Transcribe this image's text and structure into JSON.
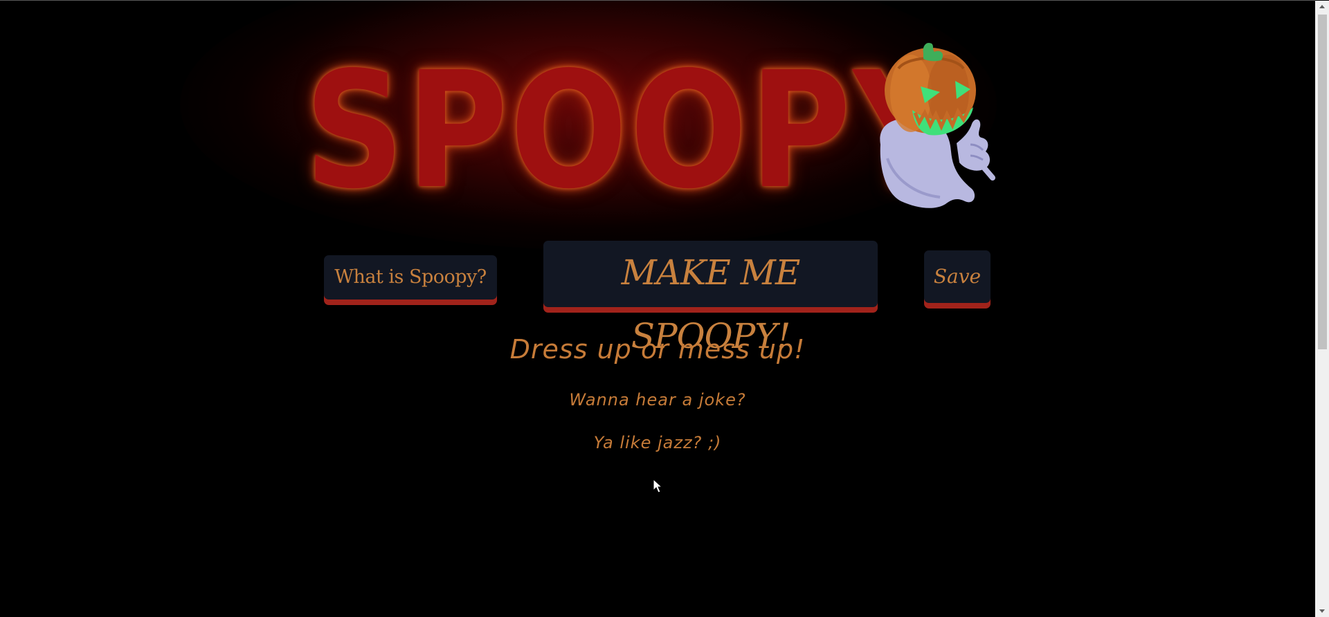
{
  "logo": {
    "text": "SPOOPY",
    "mascot_icon": "ghost-pumpkin-icon"
  },
  "buttons": {
    "what_label": "What is Spoopy?",
    "make_label": "MAKE ME SPOOPY!",
    "save_label": "Save"
  },
  "content": {
    "heading": "Dress up or mess up!",
    "joke_lines": [
      "Wanna hear a joke?",
      "Ya like jazz? ;)"
    ]
  },
  "colors": {
    "background": "#000000",
    "logo_red": "#9e1010",
    "text_orange": "#c67b38",
    "button_bg": "#121723",
    "button_shadow_red": "#a1231b"
  },
  "icons": {
    "cursor": "mouse-pointer-icon",
    "scroll_up": "chevron-up-icon",
    "scroll_down": "chevron-down-icon"
  }
}
